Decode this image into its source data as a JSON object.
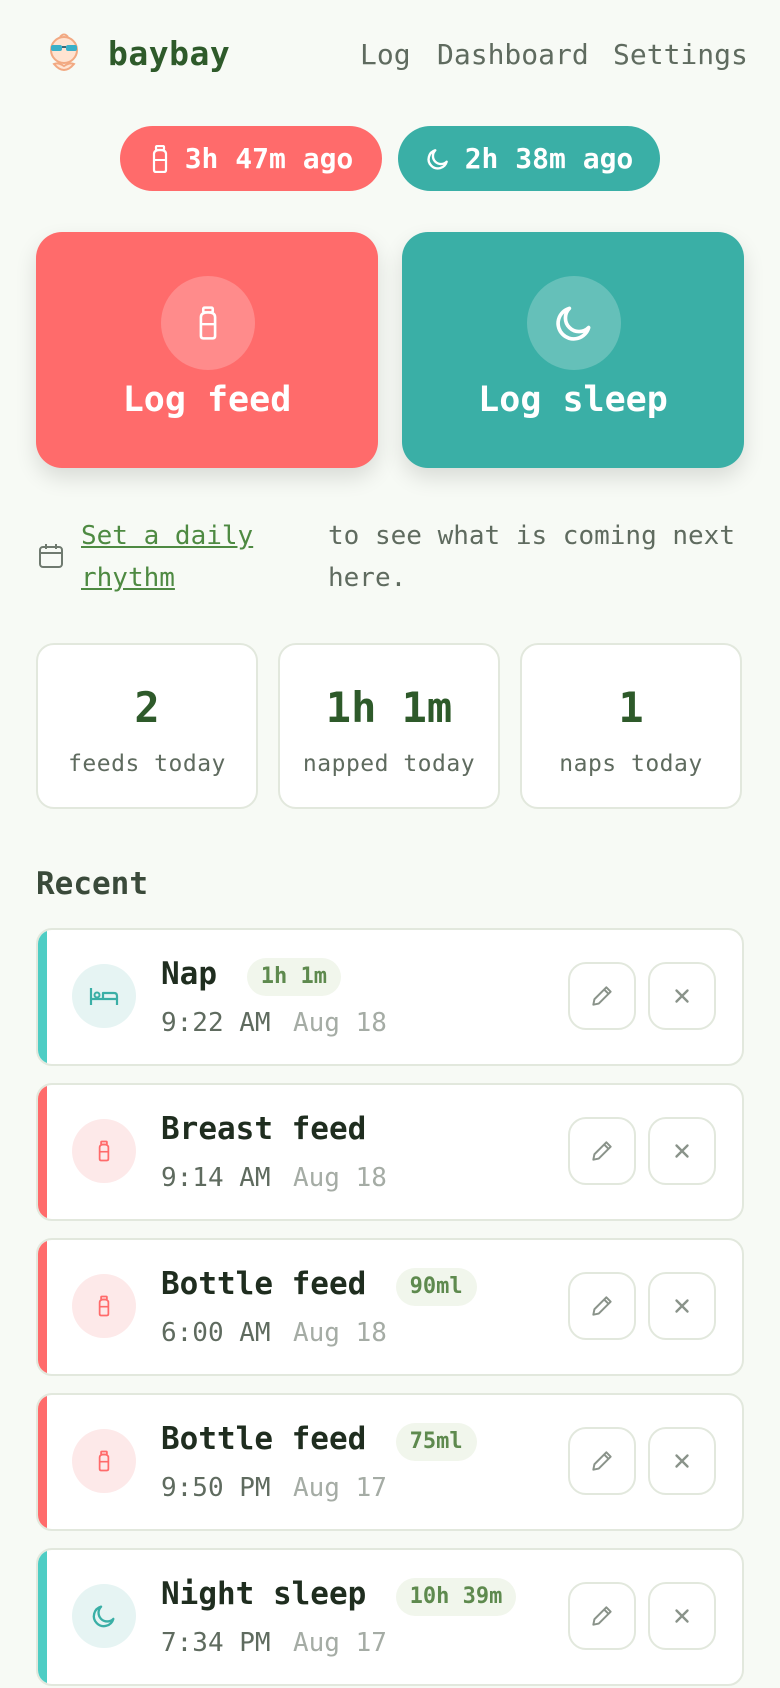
{
  "brand": {
    "name": "baybay",
    "logo_icon": "baby-sunglasses-icon"
  },
  "nav": {
    "log": "Log",
    "dashboard": "Dashboard",
    "settings": "Settings"
  },
  "since": {
    "feed": {
      "text": "3h 47m ago",
      "icon": "bottle-icon",
      "color": "#ff6b6b"
    },
    "sleep": {
      "text": "2h 38m ago",
      "icon": "moon-icon",
      "color": "#3aafa6"
    }
  },
  "actions": {
    "feed": "Log feed",
    "sleep": "Log sleep"
  },
  "rhythm": {
    "link": "Set a daily rhythm",
    "rest": "to see what is coming next here."
  },
  "stats": [
    {
      "value": "2",
      "label": "feeds today"
    },
    {
      "value": "1h 1m",
      "label": "napped today"
    },
    {
      "value": "1",
      "label": "naps today"
    }
  ],
  "recent": {
    "title": "Recent",
    "items": [
      {
        "kind": "sleep",
        "icon": "bed-icon",
        "title": "Nap",
        "badge": "1h 1m",
        "time": "9:22 AM",
        "date": "Aug 18"
      },
      {
        "kind": "feed",
        "icon": "bottle-icon",
        "title": "Breast feed",
        "badge": "",
        "time": "9:14 AM",
        "date": "Aug 18"
      },
      {
        "kind": "feed",
        "icon": "bottle-icon",
        "title": "Bottle feed",
        "badge": "90ml",
        "time": "6:00 AM",
        "date": "Aug 18"
      },
      {
        "kind": "feed",
        "icon": "bottle-icon",
        "title": "Bottle feed",
        "badge": "75ml",
        "time": "9:50 PM",
        "date": "Aug 17"
      },
      {
        "kind": "sleep",
        "icon": "moon-icon",
        "title": "Night sleep",
        "badge": "10h 39m",
        "time": "7:34 PM",
        "date": "Aug 17"
      }
    ]
  },
  "colors": {
    "feed": "#ff6b6b",
    "sleep": "#3aafa6",
    "brand": "#2e5a2a"
  }
}
